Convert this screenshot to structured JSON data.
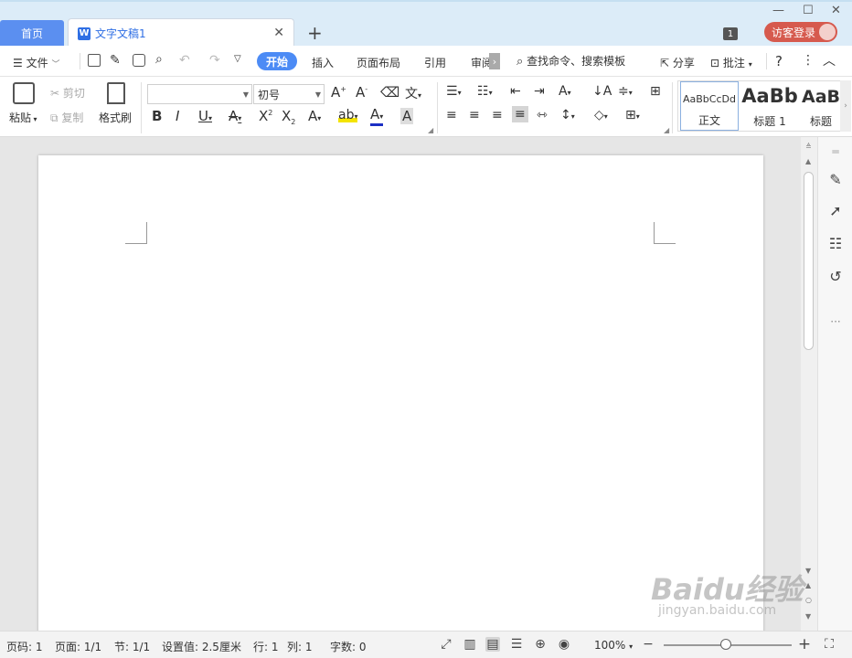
{
  "tabs": {
    "home": "首页",
    "document": "文字文稿1"
  },
  "window": {
    "badge": "1",
    "guest_login": "访客登录"
  },
  "menu": {
    "file": "文件",
    "items": [
      "开始",
      "插入",
      "页面布局",
      "引用",
      "审阅"
    ],
    "search": "查找命令、搜索模板",
    "share": "分享",
    "comment": "批注"
  },
  "ribbon": {
    "paste": "粘贴",
    "cut": "剪切",
    "copy": "复制",
    "format_painter": "格式刷",
    "font_name": "",
    "font_size": "初号",
    "styles": [
      {
        "sample": "AaBbCcDd",
        "name": "正文"
      },
      {
        "sample": "AaBb",
        "name": "标题 1"
      },
      {
        "sample": "AaB",
        "name": "标题"
      }
    ]
  },
  "status": {
    "page_num": "页码: 1",
    "pages": "页面: 1/1",
    "section": "节: 1/1",
    "setting": "设置值: 2.5厘米",
    "row": "行: 1",
    "col": "列: 1",
    "word_count": "字数: 0",
    "zoom": "100%"
  },
  "watermark": {
    "brand": "Baidu经验",
    "url": "jingyan.baidu.com"
  },
  "colors": {
    "accent": "#4c8bf5",
    "guest": "#d65a4e",
    "home_tab": "#5b8ff0"
  }
}
